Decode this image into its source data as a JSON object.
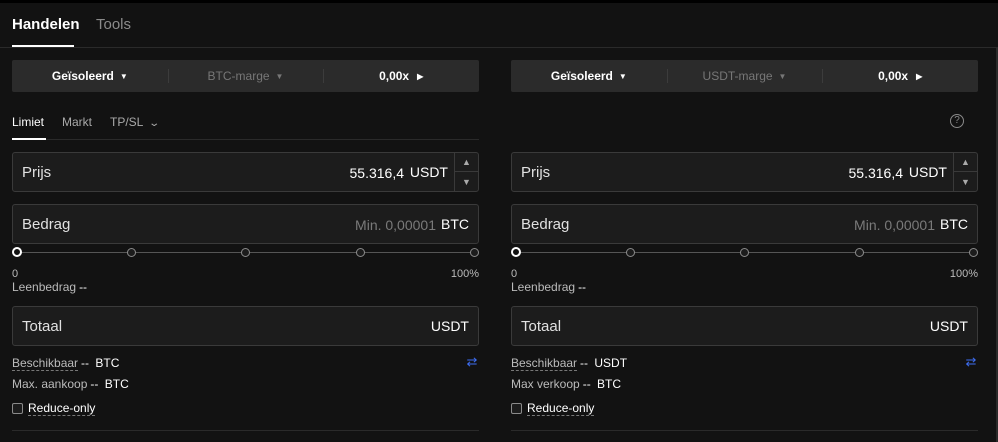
{
  "tabs": {
    "trade": "Handelen",
    "tools": "Tools"
  },
  "help_icon": "?",
  "order_types": {
    "limit": "Limiet",
    "market": "Markt",
    "tpsl": "TP/SL",
    "tpsl_icon": "chevron-down-icon"
  },
  "left": {
    "mode": {
      "margin_mode": "Geïsoleerd",
      "margin_asset": "BTC-marge",
      "leverage": "0,00x"
    },
    "price": {
      "label": "Prijs",
      "value": "55.316,4",
      "unit": "USDT"
    },
    "amount": {
      "label": "Bedrag",
      "placeholder": "Min. 0,00001",
      "unit": "BTC"
    },
    "slider": {
      "min_label": "0",
      "max_label": "100%",
      "value": 0
    },
    "loan": {
      "label": "Leenbedrag",
      "value": "--"
    },
    "total": {
      "label": "Totaal",
      "unit": "USDT"
    },
    "available": {
      "label": "Beschikbaar",
      "value": "--",
      "unit": "BTC"
    },
    "max": {
      "label": "Max. aankoop",
      "value": "--",
      "unit": "BTC"
    },
    "reduce_only": "Reduce-only"
  },
  "right": {
    "mode": {
      "margin_mode": "Geïsoleerd",
      "margin_asset": "USDT-marge",
      "leverage": "0,00x"
    },
    "price": {
      "label": "Prijs",
      "value": "55.316,4",
      "unit": "USDT"
    },
    "amount": {
      "label": "Bedrag",
      "placeholder": "Min. 0,00001",
      "unit": "BTC"
    },
    "slider": {
      "min_label": "0",
      "max_label": "100%",
      "value": 0
    },
    "loan": {
      "label": "Leenbedrag",
      "value": "--"
    },
    "total": {
      "label": "Totaal",
      "unit": "USDT"
    },
    "available": {
      "label": "Beschikbaar",
      "value": "--",
      "unit": "USDT"
    },
    "max": {
      "label": "Max verkoop",
      "value": "--",
      "unit": "BTC"
    },
    "reduce_only": "Reduce-only"
  },
  "colors": {
    "accent": "#3d6df2",
    "background": "#121212",
    "field": "#1c1c1c"
  }
}
